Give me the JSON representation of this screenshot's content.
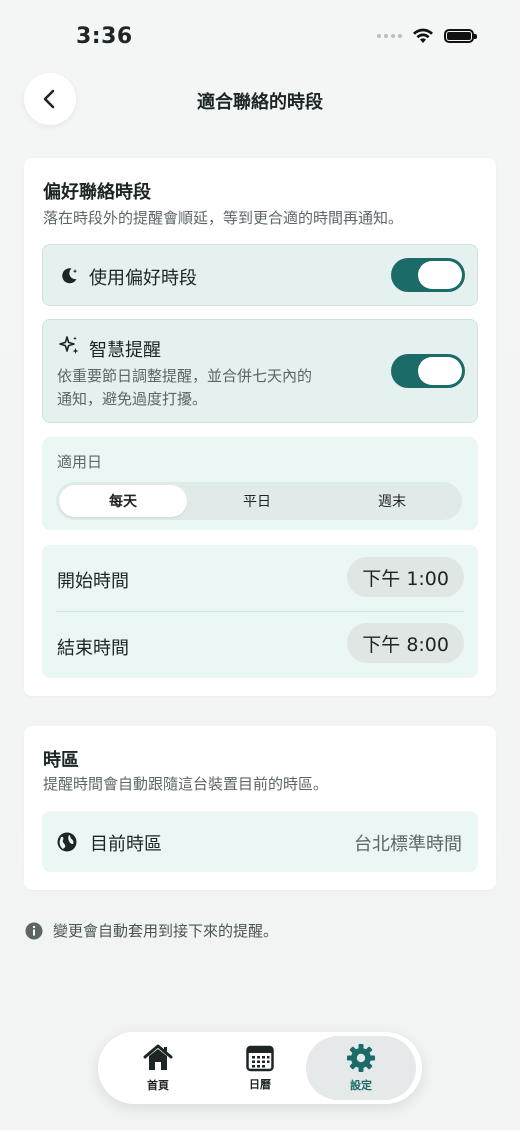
{
  "status_bar": {
    "time": "3:36"
  },
  "header": {
    "title": "適合聯絡的時段"
  },
  "preferred": {
    "title": "偏好聯絡時段",
    "description": "落在時段外的提醒會順延，等到更合適的時間再通知。",
    "use_preferred": {
      "label": "使用偏好時段",
      "enabled": true
    },
    "smart_reminder": {
      "label": "智慧提醒",
      "description_line1": "依重要節日調整提醒，並合併七天內的",
      "description_line2": "通知，避免過度打擾。",
      "enabled": true
    },
    "days": {
      "label": "適用日",
      "options": [
        "每天",
        "平日",
        "週末"
      ],
      "selected": "每天"
    },
    "start": {
      "label": "開始時間",
      "value": "下午 1:00"
    },
    "end": {
      "label": "結束時間",
      "value": "下午 8:00"
    }
  },
  "timezone": {
    "title": "時區",
    "description": "提醒時間會自動跟隨這台裝置目前的時區。",
    "current_label": "目前時區",
    "current_value": "台北標準時間"
  },
  "footer_note": "變更會自動套用到接下來的提醒。",
  "tabbar": {
    "items": [
      {
        "label": "首頁",
        "icon": "home-icon"
      },
      {
        "label": "日曆",
        "icon": "calendar-icon"
      },
      {
        "label": "設定",
        "icon": "gear-icon"
      }
    ],
    "active": "設定"
  },
  "colors": {
    "accent": "#1b6b68",
    "mint": "#eaf7f4",
    "toggle_on": "#1b6b68"
  }
}
